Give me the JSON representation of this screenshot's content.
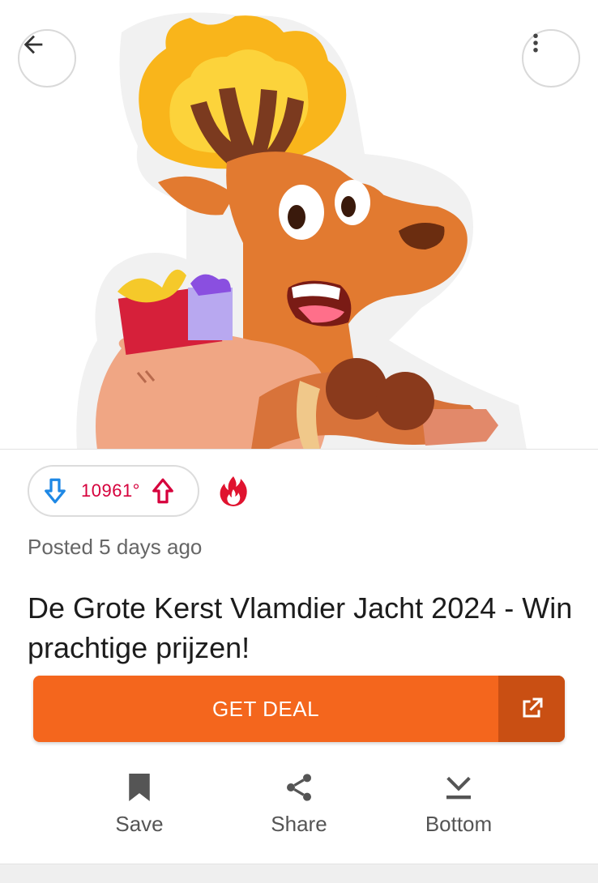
{
  "nav": {
    "back_icon": "arrow-left-icon",
    "menu_icon": "more-vertical-icon"
  },
  "deal": {
    "image_alt": "Christmas flame reindeer mascot with gift sack",
    "temperature": "10961°",
    "hot_icon": "flame-icon",
    "posted": "Posted 5 days ago",
    "title": "De Grote Kerst Vlamdier Jacht 2024 - Win prachtige prijzen!",
    "cta_label": "GET DEAL",
    "cta_icon": "external-link-icon"
  },
  "actions": {
    "save": "Save",
    "share": "Share",
    "bottom": "Bottom"
  },
  "colors": {
    "accent": "#f4661d",
    "accent_dark": "#c94f13",
    "temperature": "#d6003c",
    "vote_down": "#1e88e5",
    "vote_up": "#d6003c"
  }
}
